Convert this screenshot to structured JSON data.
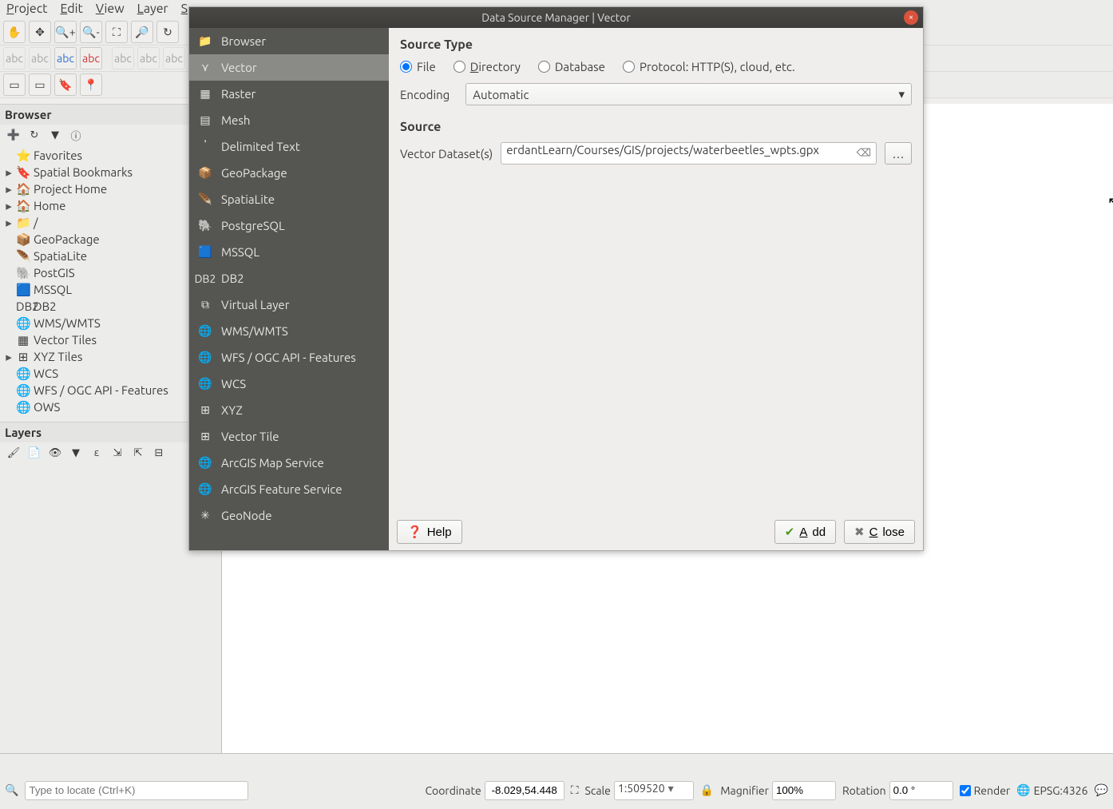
{
  "menu": {
    "items": [
      "Project",
      "Edit",
      "View",
      "Layer",
      "S"
    ]
  },
  "dialog": {
    "title": "Data Source Manager | Vector",
    "sidebar": [
      {
        "label": "Browser",
        "icon": "📁"
      },
      {
        "label": "Vector",
        "icon": "⋎"
      },
      {
        "label": "Raster",
        "icon": "▦"
      },
      {
        "label": "Mesh",
        "icon": "▤"
      },
      {
        "label": "Delimited Text",
        "icon": "𝄒"
      },
      {
        "label": "GeoPackage",
        "icon": "📦"
      },
      {
        "label": "SpatiaLite",
        "icon": "🪶"
      },
      {
        "label": "PostgreSQL",
        "icon": "🐘"
      },
      {
        "label": "MSSQL",
        "icon": "🟦"
      },
      {
        "label": "DB2",
        "icon": "DB2"
      },
      {
        "label": "Virtual Layer",
        "icon": "⧉"
      },
      {
        "label": "WMS/WMTS",
        "icon": "🌐"
      },
      {
        "label": "WFS / OGC API - Features",
        "icon": "🌐"
      },
      {
        "label": "WCS",
        "icon": "🌐"
      },
      {
        "label": "XYZ",
        "icon": "⊞"
      },
      {
        "label": "Vector Tile",
        "icon": "⊞"
      },
      {
        "label": "ArcGIS Map Service",
        "icon": "🌐"
      },
      {
        "label": "ArcGIS Feature Service",
        "icon": "🌐"
      },
      {
        "label": "GeoNode",
        "icon": "✳"
      }
    ],
    "section_source_type": "Source Type",
    "radio_file": "File",
    "radio_directory": "Directory",
    "radio_database": "Database",
    "radio_protocol": "Protocol: HTTP(S), cloud, etc.",
    "encoding_label": "Encoding",
    "encoding_value": "Automatic",
    "section_source": "Source",
    "vector_datasets_label": "Vector Dataset(s)",
    "vector_path": "erdantLearn/Courses/GIS/projects/waterbeetles_wpts.gpx",
    "browse_label": "…",
    "btn_help": "Help",
    "btn_add": "Add",
    "btn_close": "Close"
  },
  "browser_panel": {
    "title": "Browser",
    "items": [
      {
        "icon": "⭐",
        "label": "Favorites",
        "caret": ""
      },
      {
        "icon": "🔖",
        "label": "Spatial Bookmarks",
        "caret": "▸"
      },
      {
        "icon": "🏠",
        "label": "Project Home",
        "caret": "▸"
      },
      {
        "icon": "🏠",
        "label": "Home",
        "caret": "▸"
      },
      {
        "icon": "📁",
        "label": "/",
        "caret": "▸"
      },
      {
        "icon": "📦",
        "label": "GeoPackage",
        "caret": ""
      },
      {
        "icon": "🪶",
        "label": "SpatiaLite",
        "caret": ""
      },
      {
        "icon": "🐘",
        "label": "PostGIS",
        "caret": ""
      },
      {
        "icon": "🟦",
        "label": "MSSQL",
        "caret": ""
      },
      {
        "icon": "DB2",
        "label": "DB2",
        "caret": ""
      },
      {
        "icon": "🌐",
        "label": "WMS/WMTS",
        "caret": ""
      },
      {
        "icon": "▦",
        "label": "Vector Tiles",
        "caret": ""
      },
      {
        "icon": "⊞",
        "label": "XYZ Tiles",
        "caret": "▸"
      },
      {
        "icon": "🌐",
        "label": "WCS",
        "caret": ""
      },
      {
        "icon": "🌐",
        "label": "WFS / OGC API - Features",
        "caret": ""
      },
      {
        "icon": "🌐",
        "label": "OWS",
        "caret": ""
      }
    ]
  },
  "layers_panel": {
    "title": "Layers"
  },
  "statusbar": {
    "locate_placeholder": "Type to locate (Ctrl+K)",
    "coord_label": "Coordinate",
    "coord_value": "-8.029,54.448",
    "scale_label": "Scale",
    "scale_value": "1:509520",
    "magnifier_label": "Magnifier",
    "magnifier_value": "100%",
    "rotation_label": "Rotation",
    "rotation_value": "0.0 °",
    "render_label": "Render",
    "crs": "EPSG:4326"
  }
}
